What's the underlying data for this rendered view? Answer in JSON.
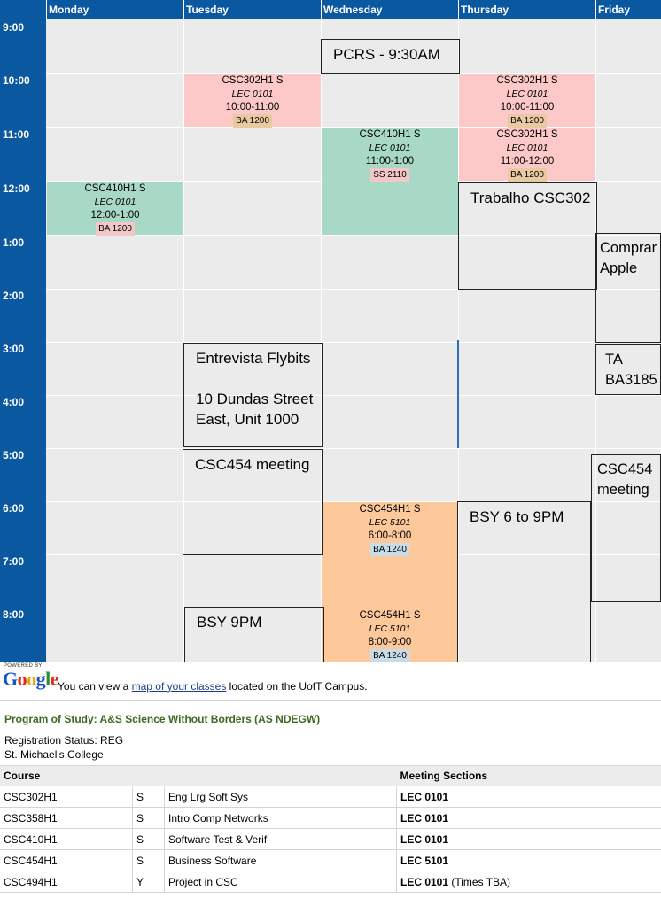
{
  "days": [
    "Monday",
    "Tuesday",
    "Wednesday",
    "Thursday",
    "Friday"
  ],
  "times": [
    "9:00",
    "10:00",
    "11:00",
    "12:00",
    "1:00",
    "2:00",
    "3:00",
    "4:00",
    "5:00",
    "6:00",
    "7:00",
    "8:00"
  ],
  "courses": [
    {
      "code": "CSC302H1 S",
      "section": "LEC 0101",
      "time": "10:00-11:00",
      "room": "BA 1200",
      "day": "Tuesday",
      "color": "#fdc8c8"
    },
    {
      "code": "CSC302H1 S",
      "section": "LEC 0101",
      "time": "10:00-11:00",
      "room": "BA 1200",
      "day": "Thursday",
      "color": "#fdc8c8"
    },
    {
      "code": "CSC410H1 S",
      "section": "LEC 0101",
      "time": "11:00-1:00",
      "room": "SS 2110",
      "day": "Wednesday",
      "color": "#a8d9c6"
    },
    {
      "code": "CSC302H1 S",
      "section": "LEC 0101",
      "time": "11:00-12:00",
      "room": "BA 1200",
      "day": "Thursday",
      "color": "#fdc8c8"
    },
    {
      "code": "CSC410H1 S",
      "section": "LEC 0101",
      "time": "12:00-1:00",
      "room": "BA 1200",
      "day": "Monday",
      "color": "#a8d9c6"
    },
    {
      "code": "CSC454H1 S",
      "section": "LEC 5101",
      "time": "6:00-8:00",
      "room": "BA 1240",
      "day": "Wednesday",
      "color": "#fdc99b"
    },
    {
      "code": "CSC454H1 S",
      "section": "LEC 5101",
      "time": "8:00-9:00",
      "room": "BA 1240",
      "day": "Wednesday",
      "color": "#fdc99b"
    }
  ],
  "notes": {
    "pcrs": "PCRS - 9:30AM",
    "trabalho": "Trabalho CSC302",
    "comprar": "Comprar\nApple",
    "entrevista": "Entrevista Flybits\n\n10 Dundas Street\nEast, Unit 1000",
    "ta": "TA\nBA3185",
    "meeting_tue": "CSC454 meeting",
    "meeting_fri": "CSC454\nmeeting",
    "bsy_thu": "BSY 6 to 9PM",
    "bsy_tue": "BSY 9PM"
  },
  "google": {
    "powered_by": "POWERED BY",
    "logo": "Google",
    "text_before": "You can view a ",
    "link": "map of your classes",
    "text_after": " located on the UofT Campus."
  },
  "program": {
    "title": "Program of Study: A&S Science Without Borders (AS NDEGW)",
    "registration": "Registration Status: REG",
    "college": "St. Michael's College",
    "headers": {
      "course": "Course",
      "meeting": "Meeting Sections"
    },
    "rows": [
      {
        "course": "CSC302H1",
        "term": "S",
        "title": "Eng Lrg Soft Sys",
        "section": "LEC 0101",
        "extra": ""
      },
      {
        "course": "CSC358H1",
        "term": "S",
        "title": "Intro Comp Networks",
        "section": "LEC 0101",
        "extra": ""
      },
      {
        "course": "CSC410H1",
        "term": "S",
        "title": "Software Test & Verif",
        "section": "LEC 0101",
        "extra": ""
      },
      {
        "course": "CSC454H1",
        "term": "S",
        "title": "Business Software",
        "section": "LEC 5101",
        "extra": ""
      },
      {
        "course": "CSC494H1",
        "term": "Y",
        "title": "Project in CSC",
        "section": "LEC 0101",
        "extra": " (Times TBA)"
      }
    ]
  },
  "colors": {
    "header_blue": "#0a58a0",
    "grid_bg": "#ebebeb",
    "program_green": "#3c6a1f",
    "link_blue": "#1a3e8a"
  }
}
